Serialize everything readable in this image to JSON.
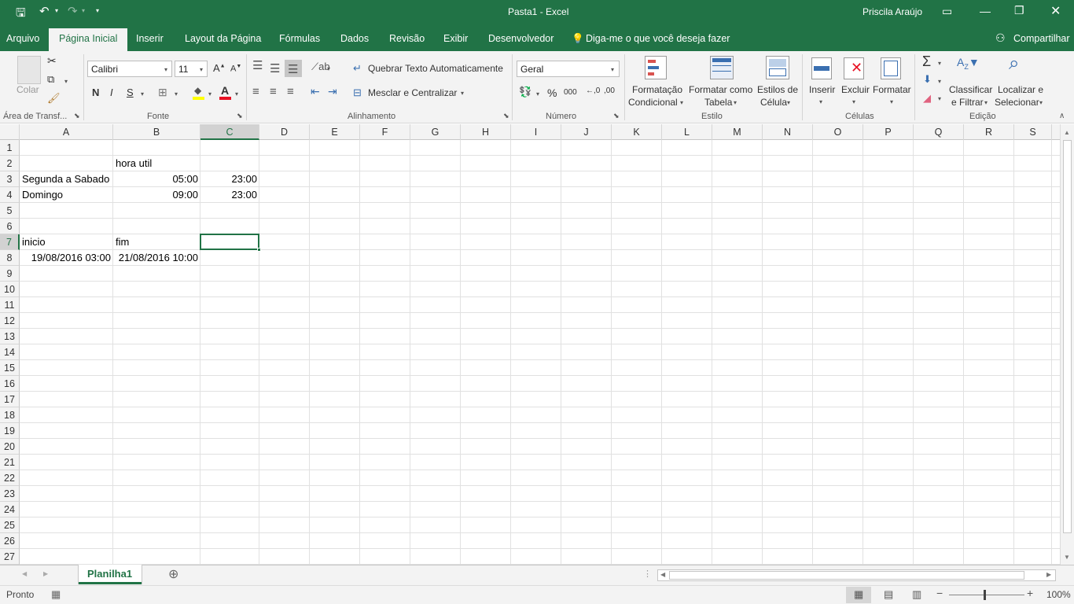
{
  "titlebar": {
    "doc_title": "Pasta1 - Excel",
    "user": "Priscila Araújo"
  },
  "menu": {
    "tabs": [
      "Arquivo",
      "Página Inicial",
      "Inserir",
      "Layout da Página",
      "Fórmulas",
      "Dados",
      "Revisão",
      "Exibir",
      "Desenvolvedor"
    ],
    "tell_me": "Diga-me o que você deseja fazer",
    "share": "Compartilhar"
  },
  "ribbon": {
    "clipboard": {
      "paste": "Colar",
      "label": "Área de Transf..."
    },
    "font": {
      "name": "Calibri",
      "size": "11",
      "bold": "N",
      "italic": "I",
      "underline": "S",
      "label": "Fonte"
    },
    "alignment": {
      "wrap": "Quebrar Texto Automaticamente",
      "merge": "Mesclar e Centralizar",
      "label": "Alinhamento"
    },
    "number": {
      "format": "Geral",
      "percent": "%",
      "thousands": "000",
      "label": "Número"
    },
    "styles": {
      "conditional_1": "Formatação",
      "conditional_2": "Condicional",
      "table_1": "Formatar como",
      "table_2": "Tabela",
      "cell_1": "Estilos de",
      "cell_2": "Célula",
      "label": "Estilo"
    },
    "cells": {
      "insert": "Inserir",
      "delete": "Excluir",
      "format": "Formatar",
      "label": "Células"
    },
    "editing": {
      "sort_1": "Classificar",
      "sort_2": "e Filtrar",
      "find_1": "Localizar e",
      "find_2": "Selecionar",
      "label": "Edição"
    }
  },
  "grid": {
    "columns": [
      "A",
      "B",
      "C",
      "D",
      "E",
      "F",
      "G",
      "H",
      "I",
      "J",
      "K",
      "L",
      "M",
      "N",
      "O",
      "P",
      "Q",
      "R",
      "S"
    ],
    "rows": [
      "1",
      "2",
      "3",
      "4",
      "5",
      "6",
      "7",
      "8",
      "9",
      "10",
      "11",
      "12",
      "13",
      "14",
      "15",
      "16",
      "17",
      "18",
      "19",
      "20",
      "21",
      "22",
      "23",
      "24",
      "25",
      "26",
      "27"
    ],
    "cells": {
      "B2": "hora util",
      "A3": "Segunda a Sabado",
      "B3": "05:00",
      "C3": "23:00",
      "A4": "Domingo",
      "B4": "09:00",
      "C4": "23:00",
      "A7": "inicio",
      "B7": "fim",
      "A8": "19/08/2016 03:00",
      "B8": "21/08/2016 10:00"
    },
    "selected_cell": "C7"
  },
  "sheets": {
    "active": "Planilha1"
  },
  "status": {
    "ready": "Pronto",
    "zoom": "100%"
  },
  "colors": {
    "accent": "#217346",
    "ribbon_bg": "#f3f3f3"
  }
}
